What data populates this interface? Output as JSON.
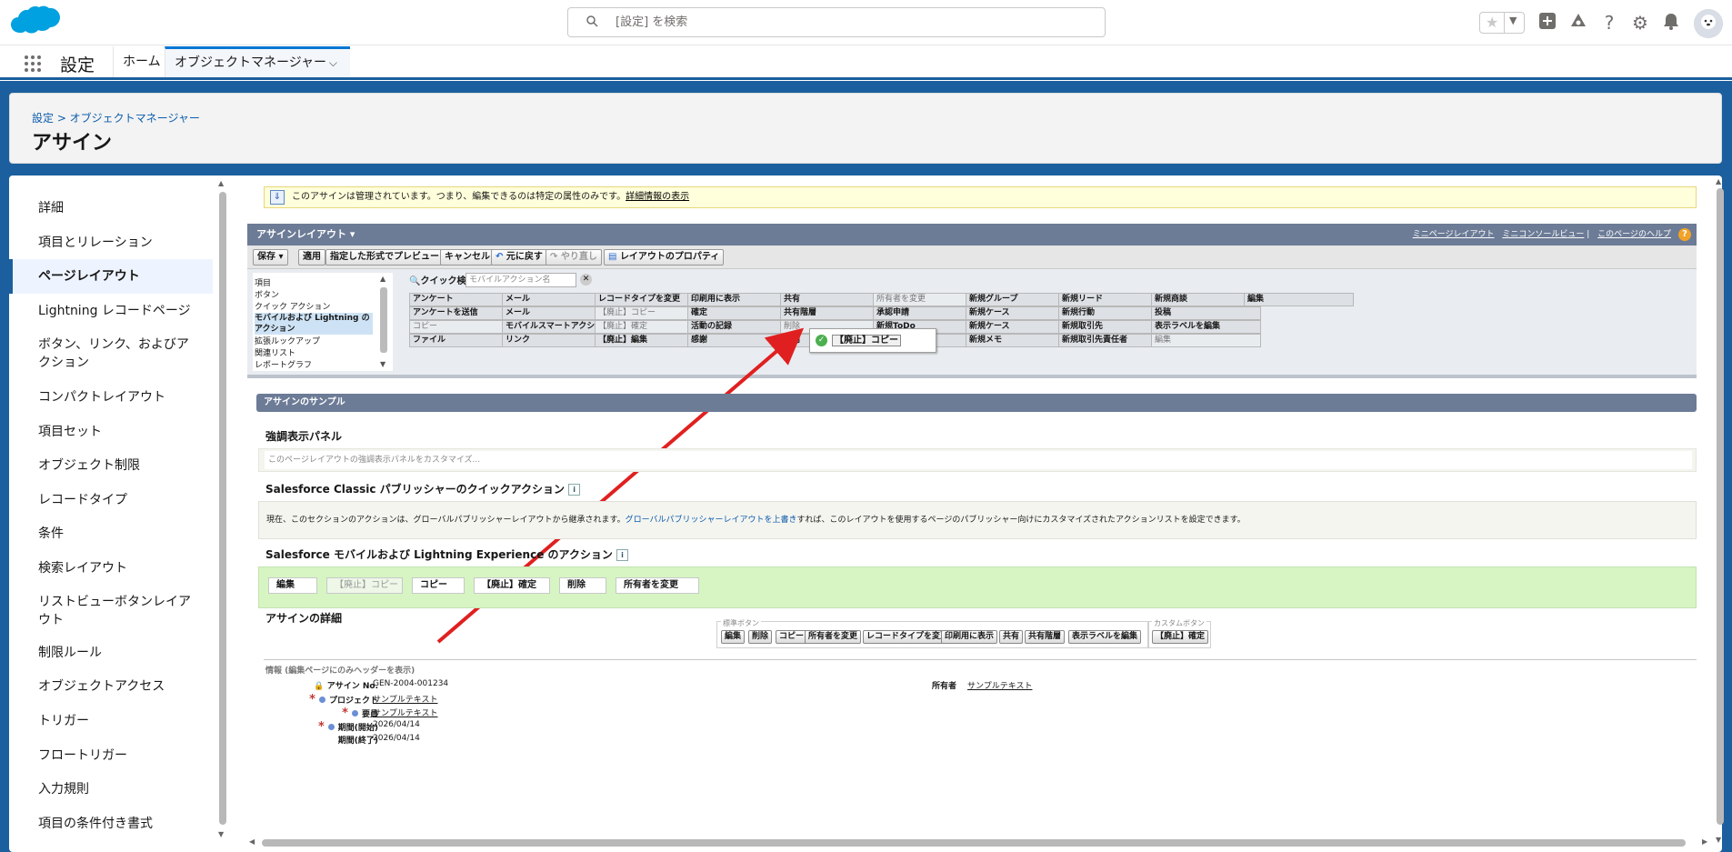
{
  "header": {
    "search_placeholder": "[設定] を検索"
  },
  "nav": {
    "app_name": "設定",
    "tabs": [
      {
        "label": "ホーム"
      },
      {
        "label": "オブジェクトマネージャー"
      }
    ]
  },
  "page": {
    "breadcrumb": "設定 > オブジェクトマネージャー",
    "title": "アサイン"
  },
  "sidebar": {
    "items": [
      {
        "label": "詳細"
      },
      {
        "label": "項目とリレーション"
      },
      {
        "label": "ページレイアウト",
        "active": true
      },
      {
        "label": "Lightning レコードページ"
      },
      {
        "label": "ボタン、リンク、およびアクション"
      },
      {
        "label": "コンパクトレイアウト"
      },
      {
        "label": "項目セット"
      },
      {
        "label": "オブジェクト制限"
      },
      {
        "label": "レコードタイプ"
      },
      {
        "label": "条件"
      },
      {
        "label": "検索レイアウト"
      },
      {
        "label": "リストビューボタンレイアウト"
      },
      {
        "label": "制限ルール"
      },
      {
        "label": "オブジェクトアクセス"
      },
      {
        "label": "トリガー"
      },
      {
        "label": "フロートリガー"
      },
      {
        "label": "入力規則"
      },
      {
        "label": "項目の条件付き書式"
      }
    ]
  },
  "notice": {
    "text": "このアサインは管理されています。つまり、編集できるのは特定の属性のみです。",
    "link": "詳細情報の表示"
  },
  "layout": {
    "title": "アサインレイアウト",
    "links": [
      "ミニページレイアウト",
      "ミニコンソールビュー",
      "このページのヘルプ"
    ],
    "help_glyph": "?",
    "toolbar": {
      "save": "保存",
      "apply": "適用",
      "preview": "指定した形式でプレビュー...",
      "cancel": "キャンセル",
      "undo": "元に戻す",
      "redo": "やり直し",
      "props": "レイアウトのプロパティ"
    },
    "palette_categories": [
      "項目",
      "ボタン",
      "クイック アクション",
      "モバイルおよび Lightning のアクション",
      "拡張ルックアップ",
      "関連リスト",
      "レポートグラフ"
    ],
    "quick_search_label": "クイック検索",
    "quick_search_placeholder": "モバイルアクション名",
    "palette_rows": [
      [
        "アンケート",
        "メール",
        "レコードタイプを変更",
        "印刷用に表示",
        "共有",
        "所有者を変更",
        "新規グループ",
        "新規リード",
        "新規商談",
        "編集"
      ],
      [
        "アンケートを送信",
        "メール",
        "【廃止】コピー",
        "確定",
        "共有階層",
        "承認申請",
        "新規ケース",
        "新規行動",
        "投稿"
      ],
      [
        "コピー",
        "モバイルスマートアクション",
        "【廃止】確定",
        "活動の記録",
        "削除",
        "新規ToDo",
        "新規ケース",
        "新規取引先",
        "表示ラベルを編集"
      ],
      [
        "ファイル",
        "リンク",
        "【廃止】編集",
        "感謝",
        "質問",
        "新規ToDo",
        "新規メモ",
        "新規取引先責任者",
        "編集"
      ]
    ],
    "drag_item": "【廃止】コピー"
  },
  "sample": {
    "header": "アサインのサンプル",
    "highlights_title": "強調表示パネル",
    "highlights_text": "このページレイアウトの強調表示パネルをカスタマイズ...",
    "classic_title": "Salesforce Classic パブリッシャーのクイックアクション",
    "classic_text_pre": "現在、このセクションのアクションは、グローバルパブリッシャーレイアウトから継承されます。",
    "classic_link": "グローバルパブリッシャーレイアウトを上書き",
    "classic_text_post": "すれば、このレイアウトを使用するページのパブリッシャー向けにカスタマイズされたアクションリストを設定できます。",
    "mobile_title": "Salesforce モバイルおよび Lightning Experience のアクション",
    "info_glyph": "i",
    "mobile_actions": [
      "編集",
      "【廃止】コピー",
      "コピー",
      "【廃止】確定",
      "削除",
      "所有者を変更"
    ],
    "detail_title": "アサインの詳細",
    "std_label": "標準ボタン",
    "std_buttons": [
      "編集",
      "削除",
      "コピー",
      "所有者を変更",
      "レコードタイプを変更",
      "印刷用に表示",
      "共有",
      "共有階層",
      "表示ラベルを編集"
    ],
    "custom_label": "カスタムボタン",
    "custom_buttons": [
      "【廃止】確定"
    ],
    "info_section": "情報 (編集ページにのみヘッダーを表示)",
    "fields": [
      {
        "label": "アサイン No.",
        "value": "GEN-2004-001234"
      },
      {
        "label": "プロジェクト",
        "value": "サンプルテキスト"
      },
      {
        "label": "要員",
        "value": "サンプルテキスト"
      },
      {
        "label": "期間(開始)",
        "value": "2026/04/14"
      },
      {
        "label": "期間(終了)",
        "value": "2026/04/14"
      }
    ],
    "owner_label": "所有者",
    "owner_value": "サンプルテキスト",
    "required_mark": "*"
  }
}
